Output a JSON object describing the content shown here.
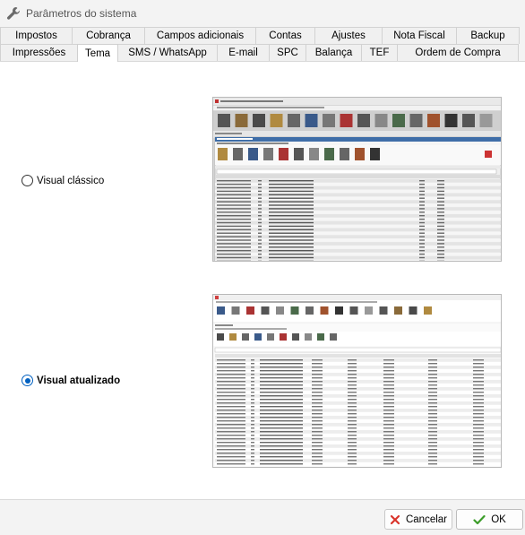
{
  "window": {
    "title": "Parâmetros do sistema"
  },
  "tabs_row1": [
    {
      "label": "Impostos",
      "name": "tab-impostos"
    },
    {
      "label": "Cobrança",
      "name": "tab-cobranca"
    },
    {
      "label": "Campos adicionais",
      "name": "tab-campos-adicionais"
    },
    {
      "label": "Contas",
      "name": "tab-contas"
    },
    {
      "label": "Ajustes",
      "name": "tab-ajustes"
    },
    {
      "label": "Nota Fiscal",
      "name": "tab-nota-fiscal"
    },
    {
      "label": "Backup",
      "name": "tab-backup"
    }
  ],
  "tabs_row2": [
    {
      "label": "Impressões",
      "name": "tab-impressoes"
    },
    {
      "label": "Tema",
      "name": "tab-tema",
      "active": true
    },
    {
      "label": "SMS / WhatsApp",
      "name": "tab-sms-whatsapp"
    },
    {
      "label": "E-mail",
      "name": "tab-email"
    },
    {
      "label": "SPC",
      "name": "tab-spc"
    },
    {
      "label": "Balança",
      "name": "tab-balanca"
    },
    {
      "label": "TEF",
      "name": "tab-tef"
    },
    {
      "label": "Ordem de Compra",
      "name": "tab-ordem-de-compra"
    }
  ],
  "theme": {
    "classic_label": "Visual clássico",
    "classic_selected": false,
    "updated_label": "Visual atualizado",
    "updated_selected": true
  },
  "buttons": {
    "cancel": "Cancelar",
    "ok": "OK"
  },
  "colors": {
    "accent": "#0060c0",
    "cancel_icon": "#d9342b",
    "ok_icon": "#3c9d2a"
  }
}
